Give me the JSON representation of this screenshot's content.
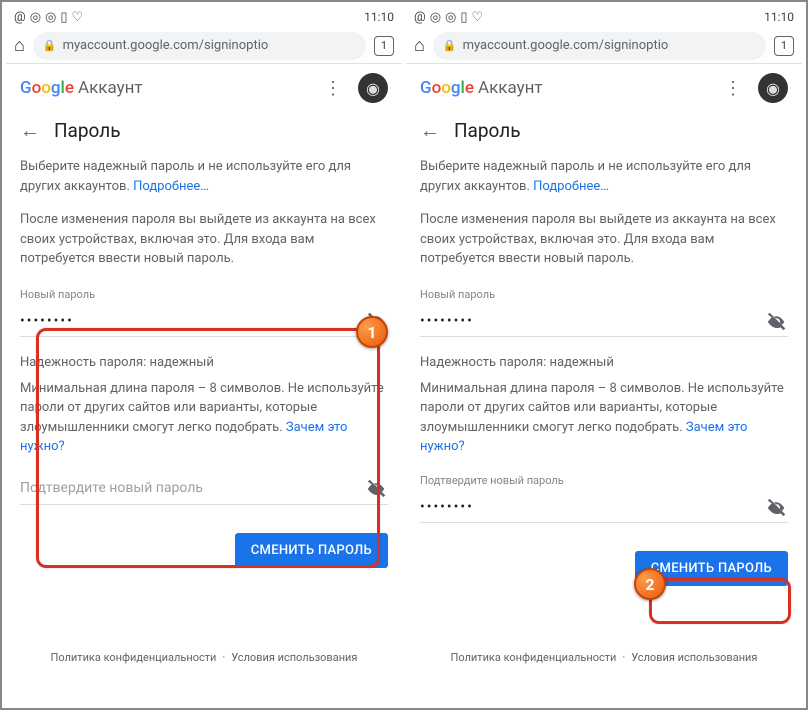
{
  "statusbar": {
    "time": "11:10"
  },
  "urlbar": {
    "url": "myaccount.google.com/signinoptio",
    "tabs": "1"
  },
  "header": {
    "brand": "Аккаунт"
  },
  "page": {
    "title": "Пароль",
    "intro1": "Выберите надежный пароль и не используйте его для других аккаунтов. ",
    "intro1_link": "Подробнее…",
    "intro2": "После изменения пароля вы выйдете из аккаунта на всех своих устройствах, включая это. Для входа вам потребуется ввести новый пароль."
  },
  "field_new": {
    "label": "Новый пароль",
    "value": "••••••••"
  },
  "strength": {
    "label": "Надежность пароля: ",
    "value": "надежный"
  },
  "helper": {
    "text": "Минимальная длина пароля – 8 символов. Не используйте пароли от других сайтов или варианты, которые злоумышленники смогут легко подобрать. ",
    "link": "Зачем это нужно?"
  },
  "field_confirm": {
    "label": "Подтвердите новый пароль",
    "placeholder": "Подтвердите новый пароль",
    "value": "••••••••"
  },
  "button": {
    "label": "СМЕНИТЬ ПАРОЛЬ"
  },
  "footer": {
    "privacy": "Политика конфиденциальности",
    "terms": "Условия использования"
  },
  "annotations": {
    "badge1": "1",
    "badge2": "2"
  }
}
